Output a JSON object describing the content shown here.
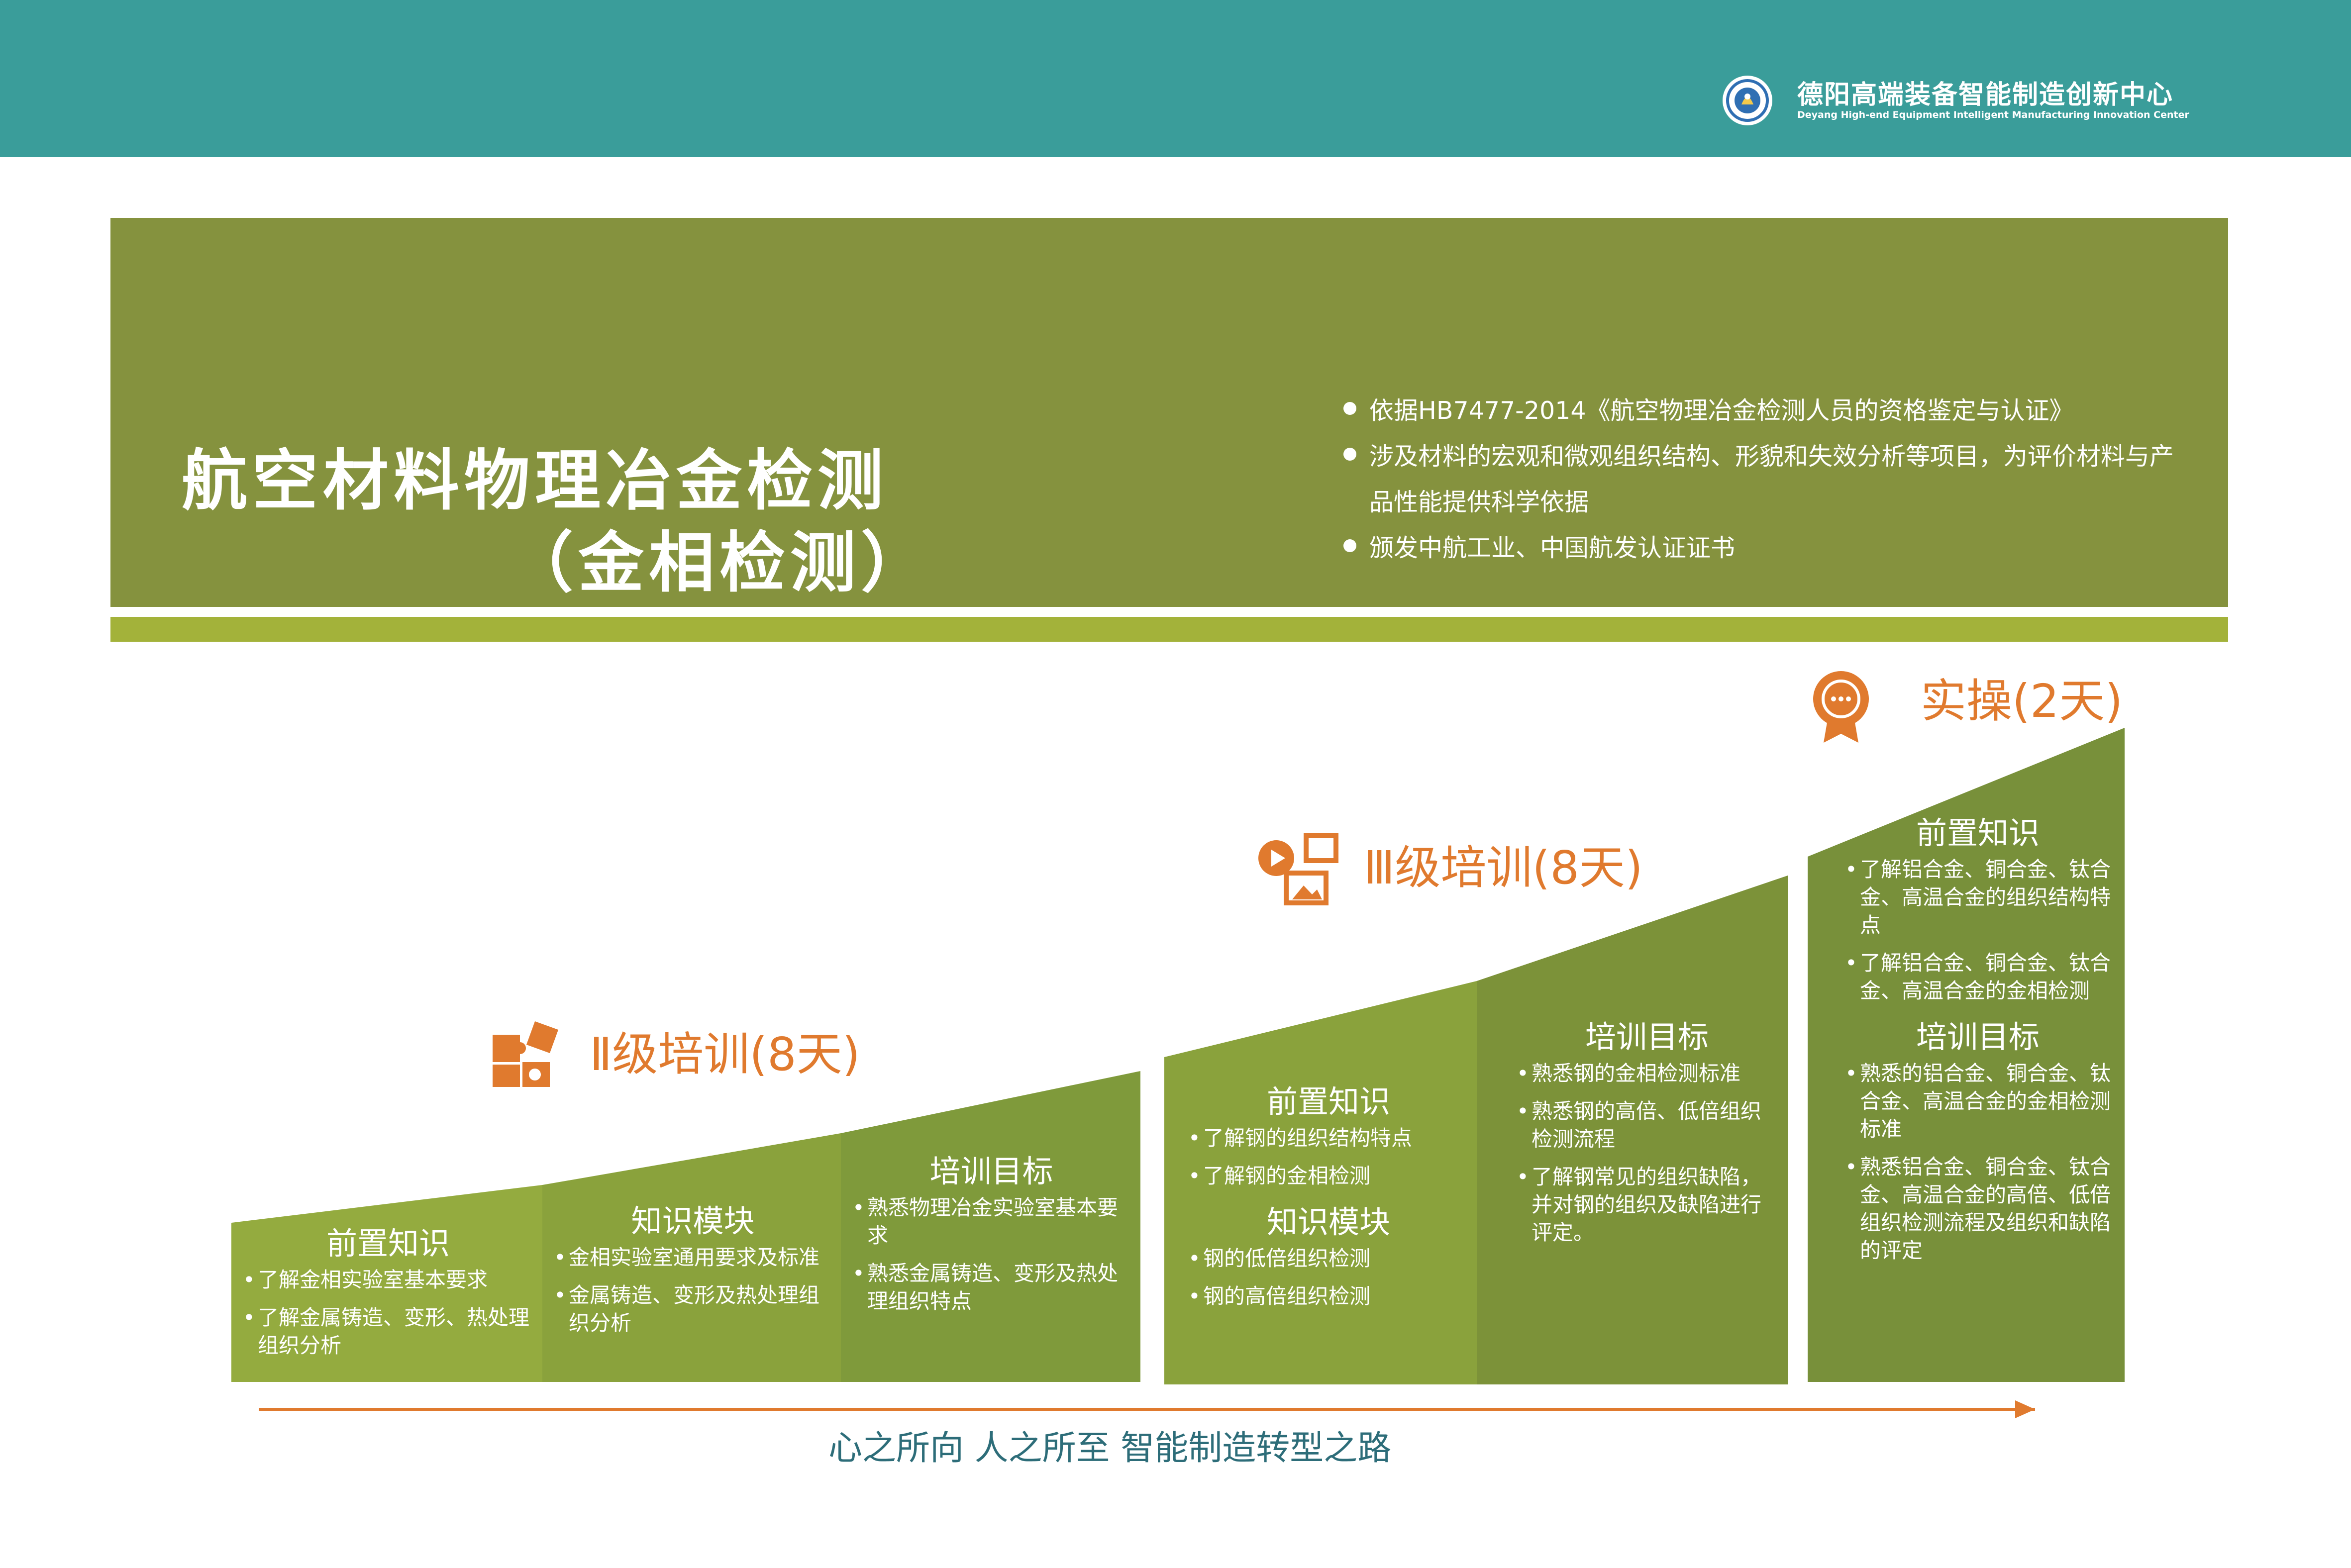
{
  "header": {
    "org_name_cn": "德阳高端装备智能制造创新中心",
    "org_name_en": "Deyang High-end Equipment Intelligent Manufacturing Innovation Center",
    "logo_icon": "org-emblem-icon",
    "bg_color": "#3a9d9a"
  },
  "banner": {
    "title_line1": "航空材料物理冶金检测",
    "title_line2": "（金相检测）",
    "bullets": [
      "依据HB7477-2014《航空物理冶金检测人员的资格鉴定与认证》",
      "涉及材料的宏观和微观组织结构、形貌和失效分析等项目，为评价材料与产品性能提供科学依据",
      "颁发中航工业、中国航发认证证书"
    ],
    "bg_color": "#85923e",
    "strip_color": "#a3b23a"
  },
  "levels": {
    "level2": {
      "heading": "Ⅱ级培训(8天)",
      "icon": "puzzle-icon",
      "blocks": [
        {
          "title": "前置知识",
          "items": [
            "了解金相实验室基本要求",
            "了解金属铸造、变形、热处理组织分析"
          ]
        },
        {
          "title": "知识模块",
          "items": [
            "金相实验室通用要求及标准",
            "金属铸造、变形及热处理组织分析"
          ]
        },
        {
          "title": "培训目标",
          "items": [
            "熟悉物理冶金实验室基本要求",
            "熟悉金属铸造、变形及热处理组织特点"
          ]
        }
      ]
    },
    "level3": {
      "heading": "Ⅲ级培训(8天)",
      "icon": "media-icon",
      "blocks": [
        {
          "title": "前置知识",
          "items": [
            "了解钢的组织结构特点",
            "了解钢的金相检测"
          ]
        },
        {
          "title": "知识模块",
          "items": [
            "钢的低倍组织检测",
            "钢的高倍组织检测"
          ]
        },
        {
          "title": "培训目标",
          "items": [
            "熟悉钢的金相检测标准",
            "熟悉钢的高倍、低倍组织检测流程",
            "了解钢常见的组织缺陷，并对钢的组织及缺陷进行评定。"
          ]
        }
      ]
    },
    "practice": {
      "heading": "实操(2天)",
      "icon": "award-badge-icon",
      "blocks": [
        {
          "title": "前置知识",
          "items": [
            "了解铝合金、铜合金、钛合金、高温合金的组织结构特点",
            "了解铝合金、铜合金、钛合金、高温合金的金相检测"
          ]
        },
        {
          "title": "培训目标",
          "items": [
            "熟悉的铝合金、铜合金、钛合金、高温合金的金相检测标准",
            "熟悉铝合金、铜合金、钛合金、高温合金的高倍、低倍组织检测流程及组织和缺陷的评定"
          ]
        }
      ]
    },
    "accent_color": "#e07a2e"
  },
  "footer": {
    "slogan": "心之所向  人之所至      智能制造转型之路",
    "slogan_color": "#2d6d79"
  }
}
